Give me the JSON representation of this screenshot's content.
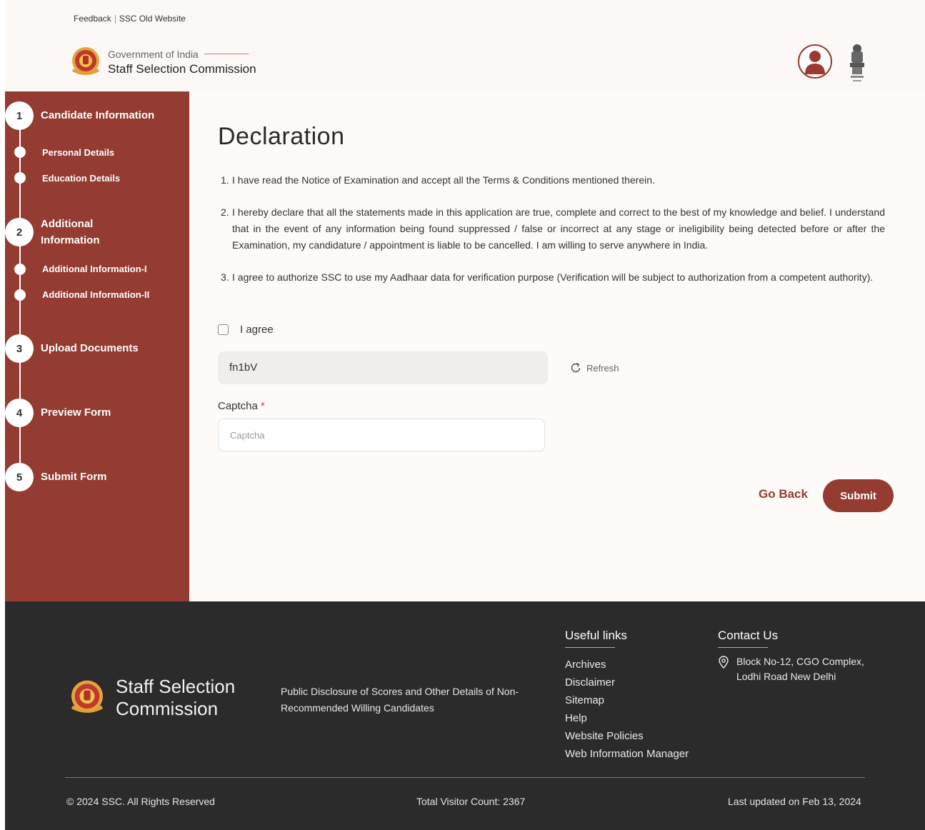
{
  "header": {
    "links": [
      "Feedback",
      "SSC Old Website"
    ],
    "gov_label": "Government of India",
    "org_name": "Staff Selection Commission",
    "icons": {
      "logo": "ssc-emblem-icon",
      "profile": "user-avatar-icon",
      "national": "national-emblem-icon"
    }
  },
  "sidebar": {
    "steps": [
      {
        "number": "1",
        "label": "Candidate Information",
        "subitems": [
          "Personal Details",
          "Education Details"
        ]
      },
      {
        "number": "2",
        "label": "Additional Information",
        "subitems": [
          "Additional Information-I",
          "Additional Information-II"
        ]
      },
      {
        "number": "3",
        "label": "Upload Documents",
        "subitems": []
      },
      {
        "number": "4",
        "label": "Preview Form",
        "subitems": []
      },
      {
        "number": "5",
        "label": "Submit Form",
        "subitems": []
      }
    ]
  },
  "main": {
    "title": "Declaration",
    "declarations": [
      {
        "num": "1.",
        "text": "I have read the Notice of Examination and accept all the Terms & Conditions mentioned therein."
      },
      {
        "num": "2.",
        "text": "I hereby declare that all the statements made in this application are true, complete and correct to the best of my knowledge and belief. I understand that in the event of any information being found suppressed / false or incorrect at any stage or ineligibility being detected before or after the Examination, my candidature / appointment is liable to be cancelled. I am willing to serve anywhere in India."
      },
      {
        "num": "3.",
        "text": "I agree to authorize SSC to use my Aadhaar data for verification purpose (Verification will be subject to authorization from a competent authority)."
      }
    ],
    "agree_label": "I agree",
    "agree_checked": false,
    "captcha_code": "fn1bV",
    "refresh_label": "Refresh",
    "captcha_label": "Captcha",
    "captcha_required": "*",
    "captcha_placeholder": "Captcha",
    "captcha_value": "",
    "go_back_label": "Go Back",
    "submit_label": "Submit",
    "accent_color": "#943b32"
  },
  "footer": {
    "brand_line1": "Staff Selection",
    "brand_line2": "Commission",
    "disclosure": "Public Disclosure of Scores and Other Details of Non-Recommended Willing Candidates",
    "useful_links_heading": "Useful links",
    "useful_links": [
      "Archives",
      "Disclaimer",
      "Sitemap",
      "Help",
      "Website Policies",
      "Web Information Manager"
    ],
    "contact_heading": "Contact Us",
    "address_line1": "Block No-12, CGO Complex,",
    "address_line2": "Lodhi Road New Delhi",
    "copyright": "© 2024 SSC. All Rights Reserved",
    "visitor_count": "Total Visitor Count: 2367",
    "last_updated": "Last updated on Feb 13, 2024"
  }
}
